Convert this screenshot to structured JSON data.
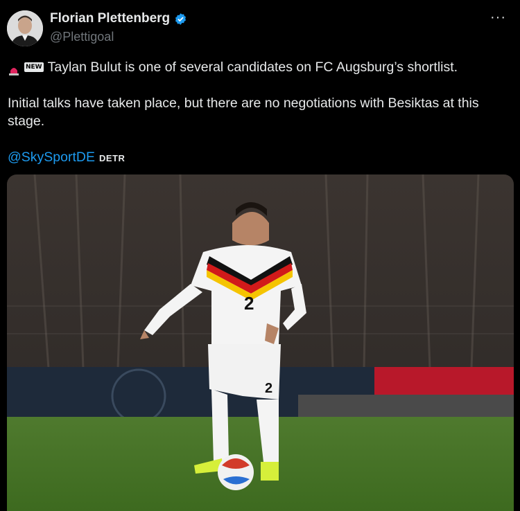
{
  "tweet": {
    "author_name": "Florian Plettenberg",
    "handle": "@Plettigoal",
    "more_label": "···",
    "line1": "Taylan Bulut is one of several candidates on FC Augsburg’s shortlist.",
    "line2": "Initial talks have taken place, but there are no negotiations with Besiktas at this stage.",
    "mention": "@SkySportDE",
    "tag": "DETR",
    "new_badge": "NEW",
    "shirt_number": "2",
    "icons": [
      "siren-emoji",
      "new-emoji",
      "verified-badge-icon",
      "more-icon"
    ]
  },
  "colors": {
    "accent": "#1d9bf0",
    "text": "#e7e9ea",
    "muted": "#71767b",
    "background": "#000000"
  }
}
